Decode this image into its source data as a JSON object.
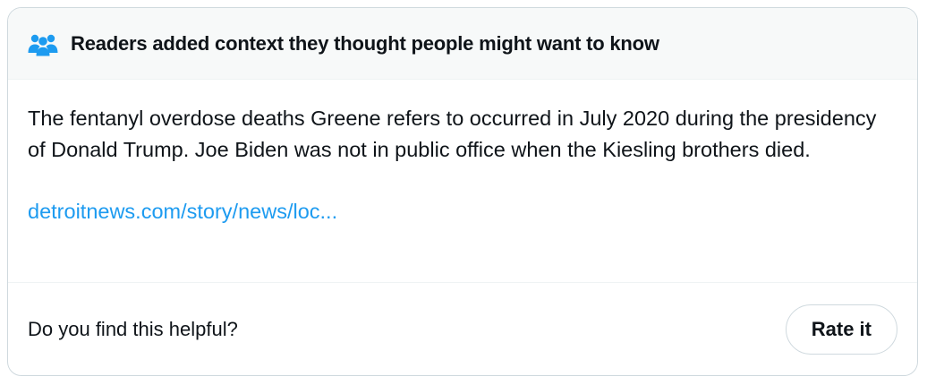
{
  "header": {
    "icon": "people-group-icon",
    "icon_color": "#1d9bf0",
    "title": "Readers added context they thought people might want to know"
  },
  "body": {
    "text": "The fentanyl overdose deaths Greene refers to occurred in July 2020 during the presidency of Donald Trump. Joe Biden was not in public office when the Kiesling brothers died.",
    "link_text": "detroitnews.com/story/news/loc...",
    "link_color": "#1d9bf0"
  },
  "footer": {
    "question": "Do you find this helpful?",
    "rate_button_label": "Rate it"
  }
}
